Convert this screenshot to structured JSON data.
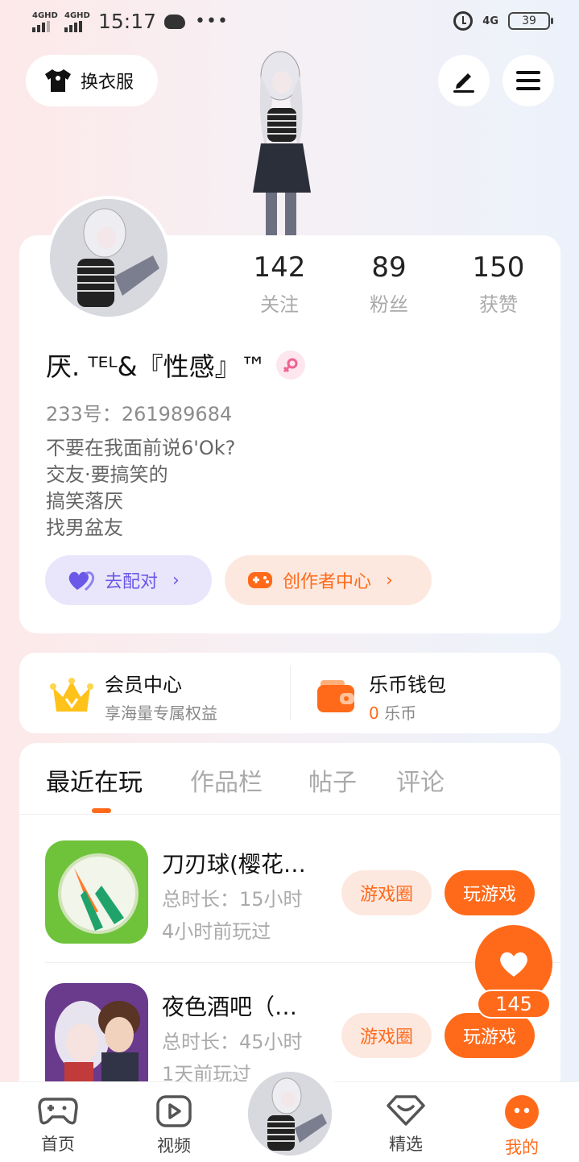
{
  "status_bar": {
    "net1": "4GHD",
    "net2": "4GHD",
    "time": "15:17",
    "dots": "•••",
    "net_right": "4G",
    "battery": "39"
  },
  "header": {
    "wardrobe_label": "换衣服"
  },
  "profile": {
    "stats": [
      {
        "value": "142",
        "label": "关注"
      },
      {
        "value": "89",
        "label": "粉丝"
      },
      {
        "value": "150",
        "label": "获赞"
      }
    ],
    "nickname": "厌. ᵀᴱᴸ&『性感』™",
    "uid_label": "233号：",
    "uid": "261989684",
    "bio": [
      "不要在我面前说6'Ok?",
      "交友·要搞笑的",
      "搞笑落厌",
      "找男盆友"
    ],
    "pair_button": "去配对",
    "creator_button": "创作者中心"
  },
  "member": {
    "vip_title": "会员中心",
    "vip_sub": "享海量专属权益",
    "wallet_title": "乐币钱包",
    "wallet_amount": "0",
    "wallet_unit": "乐币"
  },
  "tabs": [
    "最近在玩",
    "作品栏",
    "帖子",
    "评论"
  ],
  "games": [
    {
      "name": "刀刃球(樱花…",
      "duration": "总时长：15小时",
      "last_played": "4小时前玩过",
      "circle_btn": "游戏圈",
      "play_btn": "玩游戏"
    },
    {
      "name": "夜色酒吧（…",
      "duration": "总时长：45小时",
      "last_played": "1天前玩过",
      "circle_btn": "游戏圈",
      "play_btn": "玩游戏"
    }
  ],
  "fab": {
    "like_count": "145"
  },
  "bottom_nav": {
    "home": "首页",
    "video": "视频",
    "featured": "精选",
    "mine": "我的"
  },
  "colors": {
    "accent": "#ff6a1a",
    "pair": "#6a58e8"
  }
}
